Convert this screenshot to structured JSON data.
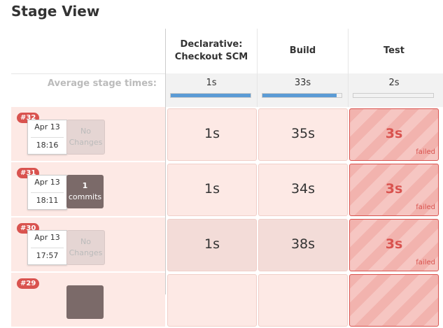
{
  "title": "Stage View",
  "avg_label": "Average stage times:",
  "stages": [
    {
      "name": "Declarative: Checkout SCM",
      "avg": "1s",
      "avg_fraction": 1.0
    },
    {
      "name": "Build",
      "avg": "33s",
      "avg_fraction": 0.94
    },
    {
      "name": "Test",
      "avg": "2s",
      "avg_fraction": 0.0
    }
  ],
  "runs": [
    {
      "badge": "#32",
      "date": "Apr 13",
      "time": "18:16",
      "changes_type": "none",
      "changes_line1": "No",
      "changes_line2": "Changes",
      "cells": [
        {
          "value": "1s",
          "status": "success"
        },
        {
          "value": "35s",
          "status": "success"
        },
        {
          "value": "3s",
          "status": "failed",
          "flag": "failed"
        }
      ]
    },
    {
      "badge": "#31",
      "date": "Apr 13",
      "time": "18:11",
      "changes_type": "has",
      "changes_line1": "1",
      "changes_line2": "commits",
      "cells": [
        {
          "value": "1s",
          "status": "success"
        },
        {
          "value": "34s",
          "status": "success"
        },
        {
          "value": "3s",
          "status": "failed",
          "flag": "failed"
        }
      ]
    },
    {
      "badge": "#30",
      "date": "Apr 13",
      "time": "17:57",
      "changes_type": "none",
      "changes_line1": "No",
      "changes_line2": "Changes",
      "cells": [
        {
          "value": "1s",
          "status": "success"
        },
        {
          "value": "38s",
          "status": "success"
        },
        {
          "value": "3s",
          "status": "failed",
          "flag": "failed"
        }
      ]
    },
    {
      "badge": "#29",
      "date": "",
      "time": "",
      "changes_type": "has",
      "changes_line1": "",
      "changes_line2": "",
      "cells": [
        {
          "value": "",
          "status": "success"
        },
        {
          "value": "",
          "status": "success"
        },
        {
          "value": "",
          "status": "failed",
          "flag": ""
        }
      ]
    }
  ],
  "colors": {
    "failed": "#d9534f",
    "progress": "#5b9bd5"
  }
}
